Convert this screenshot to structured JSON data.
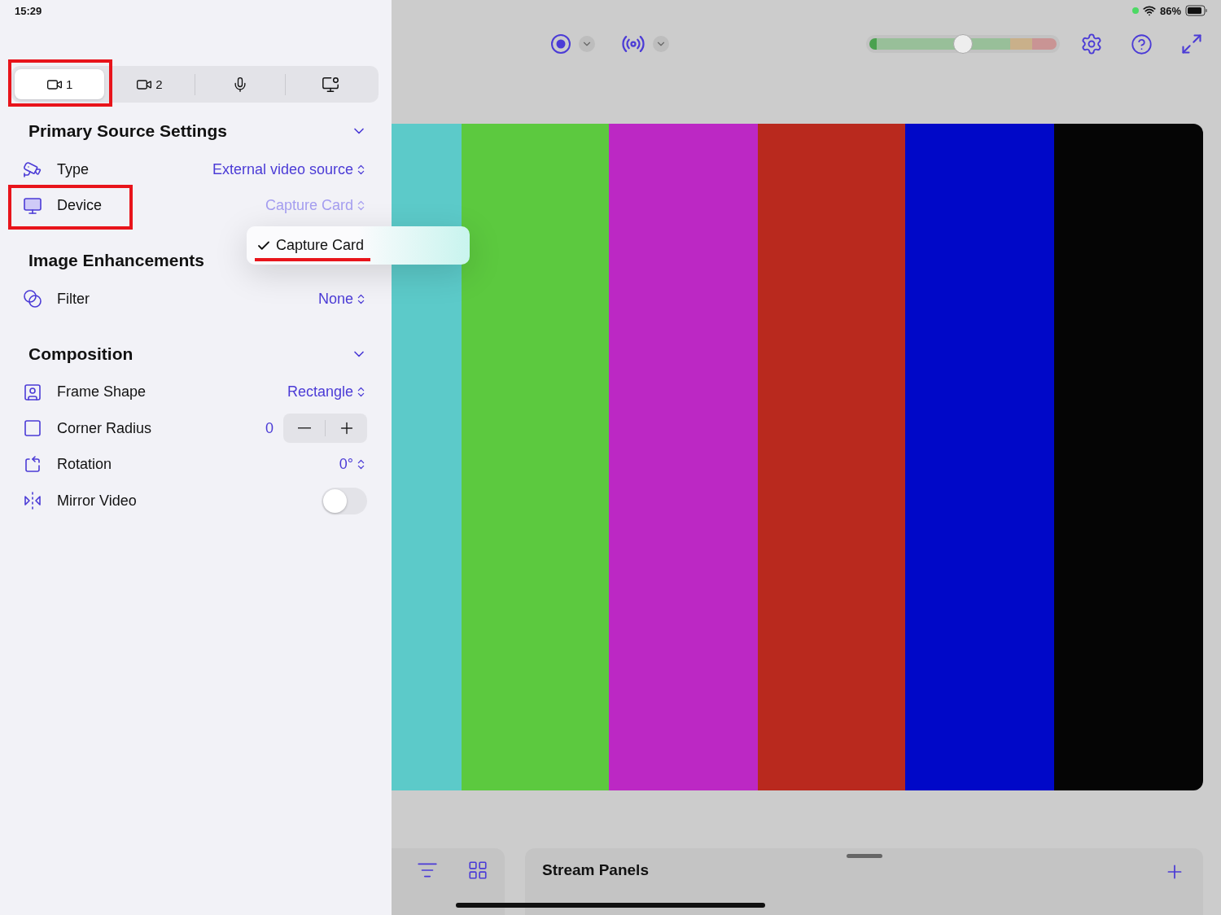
{
  "status_bar": {
    "time": "15:29",
    "battery": "86%"
  },
  "source_tabs": [
    {
      "kind": "camera",
      "label": "1",
      "selected": true,
      "annotated": true
    },
    {
      "kind": "camera",
      "label": "2",
      "selected": false,
      "annotated": false
    },
    {
      "kind": "microphone",
      "selected": false,
      "annotated": false
    },
    {
      "kind": "screen",
      "selected": false,
      "annotated": false
    }
  ],
  "sections": [
    {
      "title": "Primary Source Settings",
      "collapsible": true,
      "rows": [
        {
          "kind": "picker",
          "label": "Type",
          "value": "External video source",
          "disabled": false,
          "annotated": false
        },
        {
          "kind": "picker",
          "label": "Device",
          "value": "Capture Card",
          "disabled": true,
          "annotated": true
        }
      ]
    },
    {
      "title": "Image Enhancements",
      "collapsible": false,
      "rows": [
        {
          "kind": "picker",
          "label": "Filter",
          "value": "None",
          "disabled": false,
          "annotated": false
        }
      ]
    },
    {
      "title": "Composition",
      "collapsible": true,
      "rows": [
        {
          "kind": "picker",
          "label": "Frame Shape",
          "value": "Rectangle",
          "disabled": false,
          "annotated": false
        },
        {
          "kind": "stepper",
          "label": "Corner Radius",
          "value": "0",
          "annotated": false
        },
        {
          "kind": "picker",
          "label": "Rotation",
          "value": "0°",
          "disabled": false,
          "annotated": false
        },
        {
          "kind": "toggle",
          "label": "Mirror Video",
          "on": false,
          "annotated": false
        }
      ]
    }
  ],
  "menu": {
    "items": [
      {
        "label": "Capture Card",
        "checked": true,
        "underlined": true
      }
    ]
  },
  "toolbar": {
    "audio_level": {
      "level": 0.5
    }
  },
  "bottom": {
    "panel_title": "Stream Panels"
  }
}
